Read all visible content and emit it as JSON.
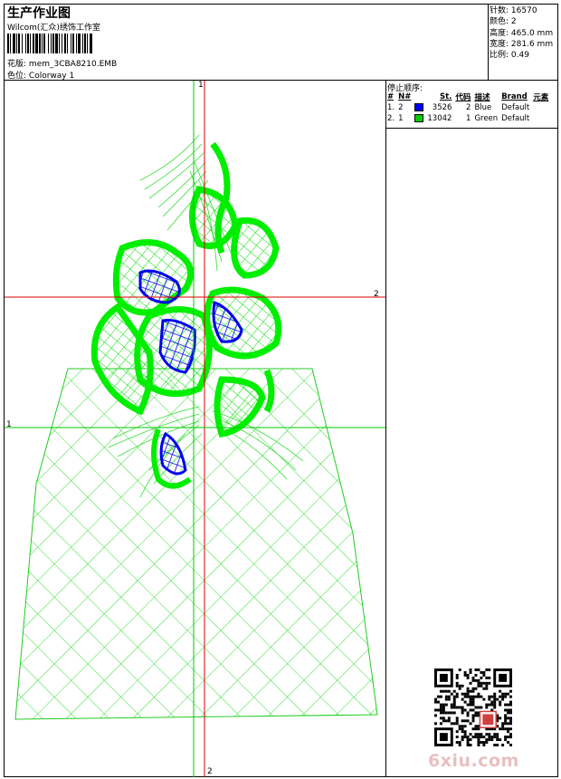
{
  "header": {
    "title": "生产作业图",
    "company": "Wilcom(汇众)绣饰工作室",
    "design_label": "花版:",
    "design_file": "mem_3CBA8210.EMB",
    "color_label": "色位:",
    "colorway": "Colorway 1"
  },
  "stats": [
    {
      "label": "针数:",
      "value": "16570"
    },
    {
      "label": "颜色:",
      "value": "2"
    },
    {
      "label": "高度:",
      "value": "465.0 mm"
    },
    {
      "label": "宽度:",
      "value": "281.6 mm"
    },
    {
      "label": "比例:",
      "value": "0.49"
    }
  ],
  "stop_sequence": {
    "title": "停止顺序:",
    "headers": [
      "#",
      "N#",
      "St.",
      "代码",
      "描述",
      "Brand",
      "元素"
    ],
    "rows": [
      {
        "index": "1.",
        "needle": "2",
        "color": "#0000ff",
        "stitches": "3526",
        "code": "2",
        "description": "Blue",
        "brand": "Default"
      },
      {
        "index": "2.",
        "needle": "1",
        "color": "#00cc00",
        "stitches": "13042",
        "code": "1",
        "description": "Green",
        "brand": "Default"
      }
    ]
  },
  "axes": {
    "v_top": "1",
    "h_right": "2",
    "h_left": "1",
    "v_bottom": "2"
  },
  "colors": {
    "thread_blue": "#0000ff",
    "thread_green": "#00ee00",
    "axis_red": "#dd0000",
    "axis_green": "#00cc00"
  },
  "watermark": "6xiu.com",
  "icons": [
    "barcode-icon",
    "qr-code-icon"
  ]
}
